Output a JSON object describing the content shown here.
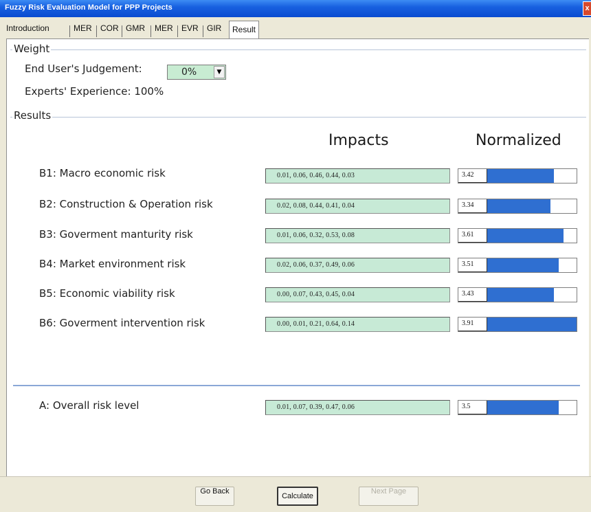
{
  "window": {
    "title": "Fuzzy Risk Evaluation Model for PPP Projects",
    "close_label": "x"
  },
  "tabs": [
    "Introduction",
    "MER",
    "COR",
    "GMR",
    "MER",
    "EVR",
    "GIR",
    "Result"
  ],
  "active_tab": "Result",
  "weight": {
    "legend": "Weight",
    "end_user_label": "End User's Judgement:",
    "end_user_value": "0%",
    "experts_label": "Experts' Experience: 100%"
  },
  "results": {
    "legend": "Results",
    "impacts_heading": "Impacts",
    "normalized_heading": "Normalized",
    "rows": [
      {
        "label": "B1: Macro economic risk",
        "impacts": "0.01, 0.06, 0.46, 0.44, 0.03",
        "normalized": "3.42",
        "level": 0.81
      },
      {
        "label": "B2: Construction & Operation risk",
        "impacts": "0.02, 0.08, 0.44, 0.41, 0.04",
        "normalized": "3.34",
        "level": 0.78
      },
      {
        "label": "B3: Goverment manturity risk",
        "impacts": "0.01, 0.06, 0.32, 0.53, 0.08",
        "normalized": "3.61",
        "level": 0.89
      },
      {
        "label": "B4: Market environment risk",
        "impacts": "0.02, 0.06, 0.37, 0.49, 0.06",
        "normalized": "3.51",
        "level": 0.85
      },
      {
        "label": "B5: Economic viability risk",
        "impacts": "0.00, 0.07, 0.43, 0.45, 0.04",
        "normalized": "3.43",
        "level": 0.81
      },
      {
        "label": "B6: Goverment intervention risk",
        "impacts": "0.00, 0.01, 0.21, 0.64, 0.14",
        "normalized": "3.91",
        "level": 1.0
      }
    ],
    "overall": {
      "label": "A: Overall risk level",
      "impacts": "0.01, 0.07, 0.39, 0.47, 0.06",
      "normalized": "3.5",
      "level": 0.85
    }
  },
  "buttons": {
    "back": "Go Back",
    "calculate": "Calculate",
    "next": "Next Page"
  },
  "colors": {
    "title_bar": "#0a4bd0",
    "bar_fill": "#2f6fd1",
    "field_bg": "#c7ead6"
  }
}
